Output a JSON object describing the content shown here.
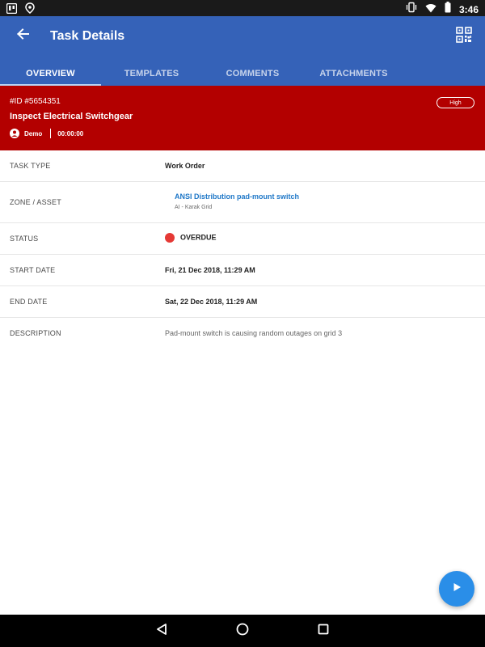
{
  "status_bar": {
    "time": "3:46",
    "left_icons": [
      "trello-icon",
      "location-pin-icon"
    ],
    "right_icons": [
      "vibrate-icon",
      "wifi-icon",
      "battery-icon"
    ]
  },
  "app_bar": {
    "back_icon": "arrow-back-icon",
    "title": "Task Details",
    "qr_icon": "qr-code-icon"
  },
  "tabs": [
    {
      "label": "OVERVIEW",
      "active": true
    },
    {
      "label": "TEMPLATES",
      "active": false
    },
    {
      "label": "COMMENTS",
      "active": false
    },
    {
      "label": "ATTACHMENTS",
      "active": false
    }
  ],
  "task": {
    "id": "#ID #5654351",
    "name": "Inspect Electrical Switchgear",
    "user": "Demo",
    "timer": "00:00:00",
    "priority": "High",
    "header_color": "#b30000"
  },
  "details": {
    "task_type": {
      "label": "TASK TYPE",
      "value": "Work Order"
    },
    "zone_asset": {
      "label": "ZONE / ASSET",
      "value": "ANSI Distribution pad-mount switch",
      "sub": "AI - Karak Grid"
    },
    "status": {
      "label": "STATUS",
      "value": "OVERDUE",
      "color": "#e53935"
    },
    "start_date": {
      "label": "START DATE",
      "value": "Fri, 21 Dec 2018, 11:29 AM"
    },
    "end_date": {
      "label": "END DATE",
      "value": "Sat, 22 Dec 2018, 11:29 AM"
    },
    "description": {
      "label": "DESCRIPTION",
      "value": "Pad-mount switch is causing random outages on grid 3"
    }
  },
  "fab": {
    "icon": "play-icon"
  },
  "nav_bar": {
    "icons": [
      "back-triangle-icon",
      "home-circle-icon",
      "recents-square-icon"
    ]
  },
  "colors": {
    "primary": "#3562b8",
    "accent": "#2a8ee8",
    "link": "#1f78c8"
  }
}
